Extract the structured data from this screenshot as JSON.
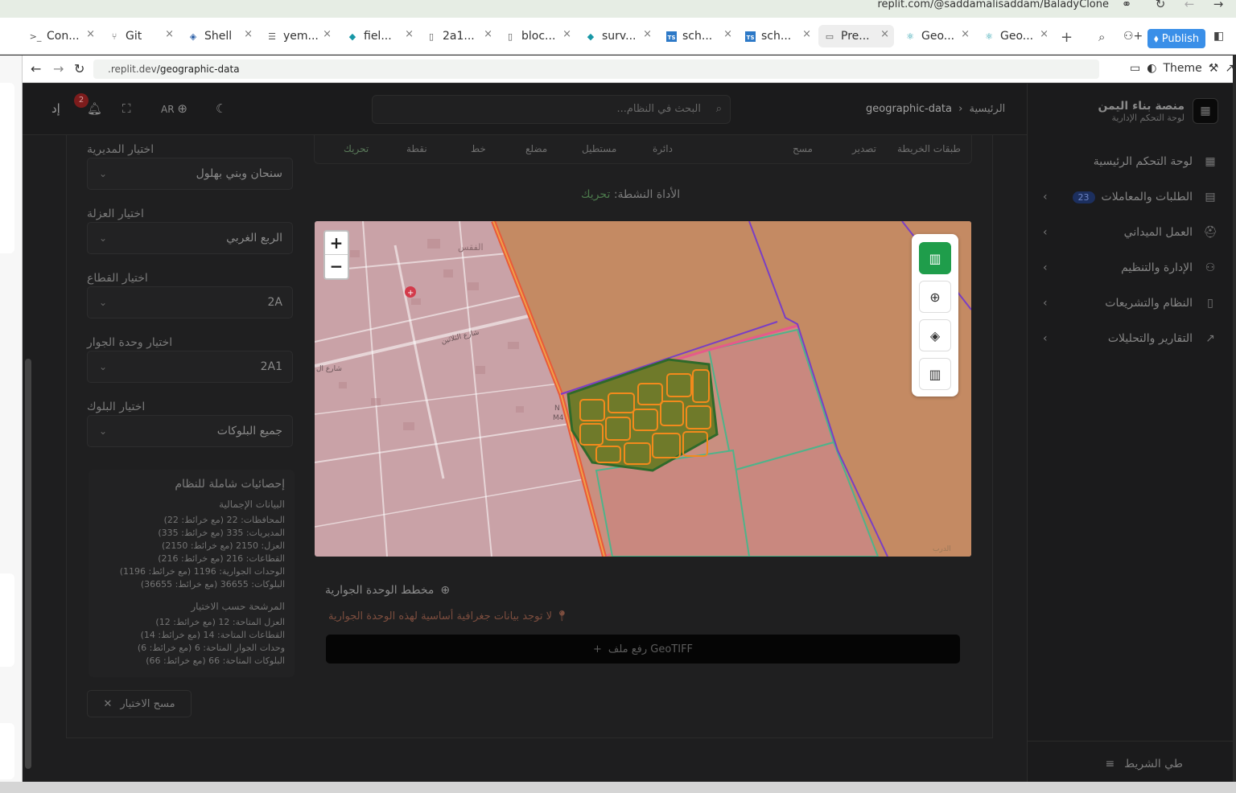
{
  "browser": {
    "replit_url": "replit.com/@saddamalisaddam/BaladyClone",
    "tabs": [
      {
        "label": "Con...",
        "icon": "console-icon"
      },
      {
        "label": "Git",
        "icon": "git-icon"
      },
      {
        "label": "Shell",
        "icon": "shell-icon"
      },
      {
        "label": "yem...",
        "icon": "database-icon"
      },
      {
        "label": "fiel...",
        "icon": "drizzle-icon"
      },
      {
        "label": "2a1...",
        "icon": "file-icon"
      },
      {
        "label": "bloc...",
        "icon": "file-icon"
      },
      {
        "label": "surv...",
        "icon": "drizzle-icon"
      },
      {
        "label": "sch...",
        "icon": "ts-icon"
      },
      {
        "label": "sch...",
        "icon": "ts-icon"
      },
      {
        "label": "Pre...",
        "icon": "preview-icon"
      },
      {
        "label": "Geo...",
        "icon": "react-icon"
      },
      {
        "label": "Geo...",
        "icon": "react-icon"
      }
    ],
    "publish_label": "Publish",
    "url_host": ".replit.dev",
    "url_path": "/geographic-data",
    "theme_label": "Theme"
  },
  "app": {
    "brand_title": "منصة بناء اليمن",
    "brand_subtitle": "لوحة التحكم الإدارية",
    "nav": [
      {
        "label": "لوحة التحكم الرئيسية",
        "icon": "dashboard-icon"
      },
      {
        "label": "الطلبات والمعاملات",
        "icon": "clipboard-icon",
        "badge": "23"
      },
      {
        "label": "العمل الميداني",
        "icon": "helmet-icon"
      },
      {
        "label": "الإدارة والتنظيم",
        "icon": "users-icon"
      },
      {
        "label": "النظام والتشريعات",
        "icon": "book-icon"
      },
      {
        "label": "التقارير والتحليلات",
        "icon": "trend-icon"
      }
    ],
    "collapse_label": "طي الشريط",
    "header": {
      "breadcrumb_home": "الرئيسية",
      "breadcrumb_current": "geographic-data",
      "search_placeholder": "البحث في النظام...",
      "lang": "AR",
      "notifications_count": "2",
      "user_initial": "إد"
    },
    "filters": [
      {
        "label": "اختيار المديرية",
        "value": "سنحان وبني بهلول"
      },
      {
        "label": "اختيار العزلة",
        "value": "الربع الغربي"
      },
      {
        "label": "اختيار القطاع",
        "value": "2A"
      },
      {
        "label": "اختيار وحدة الجوار",
        "value": "2A1"
      },
      {
        "label": "اختيار البلوك",
        "value": "جميع البلوكات"
      }
    ],
    "stats": {
      "title": "إحصائيات شاملة للنظام",
      "totals_heading": "البيانات الإجمالية",
      "totals": [
        "المحافظات: 22 (مع خرائط: 22)",
        "المديريات: 335 (مع خرائط: 335)",
        "العزل: 2150 (مع خرائط: 2150)",
        "القطاعات: 216 (مع خرائط: 216)",
        "الوحدات الجوارية: 1196 (مع خرائط: 1196)",
        "البلوكات: 36655 (مع خرائط: 36655)"
      ],
      "filtered_heading": "المرشحة حسب الاختيار",
      "filtered": [
        "العزل المتاحة: 12 (مع خرائط: 12)",
        "القطاعات المتاحة: 14 (مع خرائط: 14)",
        "وحدات الجوار المتاحة: 6 (مع خرائط: 6)",
        "البلوكات المتاحة: 66 (مع خرائط: 66)"
      ]
    },
    "clear_label": "مسح الاختيار",
    "tools": [
      "طبقات الخريطة",
      "تصدير",
      "مسح",
      "دائرة",
      "مستطيل",
      "مضلع",
      "خط",
      "نقطة",
      "تحريك"
    ],
    "active_tool_label": "الأداة النشطة:",
    "active_tool_value": "تحريك",
    "map": {
      "zoom_in": "+",
      "zoom_out": "−",
      "place_label": "الفقس",
      "street_1": "شارع الثلاثين",
      "street_2": "شارع ال",
      "road_marker": "N",
      "road_marker_2": "M4",
      "corner_label": "الدرب",
      "tools": [
        "map-icon",
        "globe-icon",
        "layers-icon",
        "map-outline-icon"
      ]
    },
    "neighborhood_title": "مخطط الوحدة الجوارية",
    "no_data_msg": "لا توجد بيانات جغرافية أساسية لهذه الوحدة الجوارية",
    "upload_label": "رفع ملف GeoTIFF"
  },
  "colors": {
    "publish": "#3a8fe8",
    "active_map_tool": "#1f9d4b",
    "sector_fill": "#c9876a",
    "block_fill": "#6f7a2a",
    "block_stroke": "#f28a1c",
    "boundary": "#7a3fc4"
  }
}
